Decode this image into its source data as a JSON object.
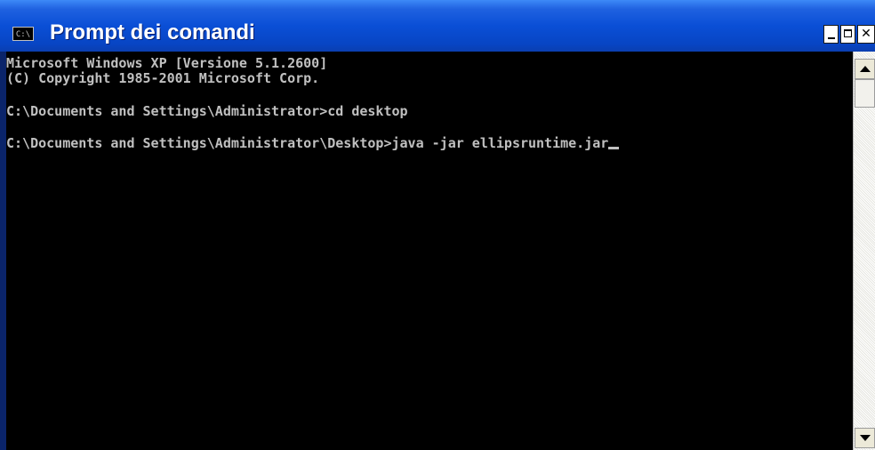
{
  "window": {
    "title": "Prompt dei comandi",
    "icon": "console-app-icon",
    "icon_text": "C:\\",
    "controls": {
      "minimize_icon": "minimize-icon",
      "maximize_icon": "maximize-icon",
      "close_icon": "close-icon",
      "close_glyph": "✕"
    }
  },
  "console": {
    "lines": [
      "Microsoft Windows XP [Versione 5.1.2600]",
      "(C) Copyright 1985-2001 Microsoft Corp.",
      "",
      "C:\\Documents and Settings\\Administrator>cd desktop",
      "",
      "C:\\Documents and Settings\\Administrator\\Desktop>java -jar ellipsruntime.jar"
    ],
    "text_color": "#c0c0c0",
    "background_color": "#000000"
  },
  "scrollbar": {
    "up_icon": "scroll-up-arrow-icon",
    "down_icon": "scroll-down-arrow-icon",
    "position_fraction": 0
  },
  "colors": {
    "titlebar": "#0a4fd6",
    "title_text": "#ffffff"
  }
}
